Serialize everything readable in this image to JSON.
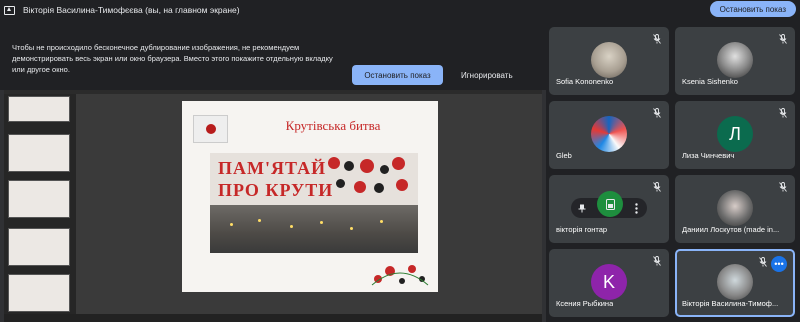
{
  "topbar": {
    "title": "Вікторія Василина-Тимофєєва (вы, на главном экране)",
    "stop_label": "Остановить показ"
  },
  "warning": {
    "text": "Чтобы не происходило бесконечное дублирование изображения, не рекомендуем демонстрировать весь экран или окно браузера. Вместо этого покажите отдельную вкладку или другое окно.",
    "stop_label": "Остановить показ",
    "ignore_label": "Игнорировать"
  },
  "slide": {
    "title": "Крутівська битва",
    "line1": "ПАМ'ЯТАЙ",
    "line2": "ПРО КРУТИ"
  },
  "participants": [
    {
      "name": "Sofia Kononenko",
      "avatar": "photo"
    },
    {
      "name": "Ksenia Sishenko",
      "avatar": "photo"
    },
    {
      "name": "Gleb",
      "avatar": "swirl-logo"
    },
    {
      "name": "Лиза Чинчевич",
      "avatar_letter": "Л",
      "color": "#0b6b4e"
    },
    {
      "name": "вікторія гонтар",
      "avatar": "controls-overlay"
    },
    {
      "name": "Даниил Лоскутов (made in...",
      "avatar": "photo"
    },
    {
      "name": "Ксения Рыбкина",
      "avatar_letter": "K",
      "color": "#8e24aa"
    },
    {
      "name": "Вікторія Василина-Тимоф...",
      "avatar": "photo"
    }
  ],
  "colors": {
    "accent": "#8ab4f8",
    "tile_bg": "#3c4043",
    "page_bg": "#202124"
  }
}
